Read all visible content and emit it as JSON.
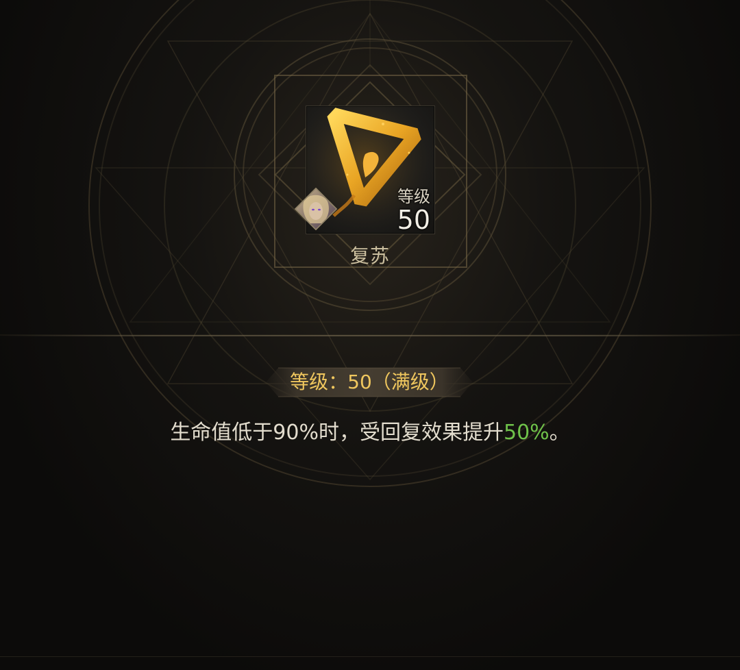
{
  "skill": {
    "name": "复苏",
    "level_label": "等级",
    "level_value": "50",
    "icon": "golden-triangle-rune-icon",
    "portrait": "hero-portrait-icon"
  },
  "banner": {
    "text": "等级：50（满级）"
  },
  "description": {
    "before": "生命值低于90%时，受回复效果提升",
    "highlight": "50%",
    "after": "。"
  },
  "colors": {
    "banner_text": "#f0c75e",
    "highlight": "#6fc24a",
    "body_text": "#e3ddce",
    "skill_name": "#cbbf9f"
  }
}
